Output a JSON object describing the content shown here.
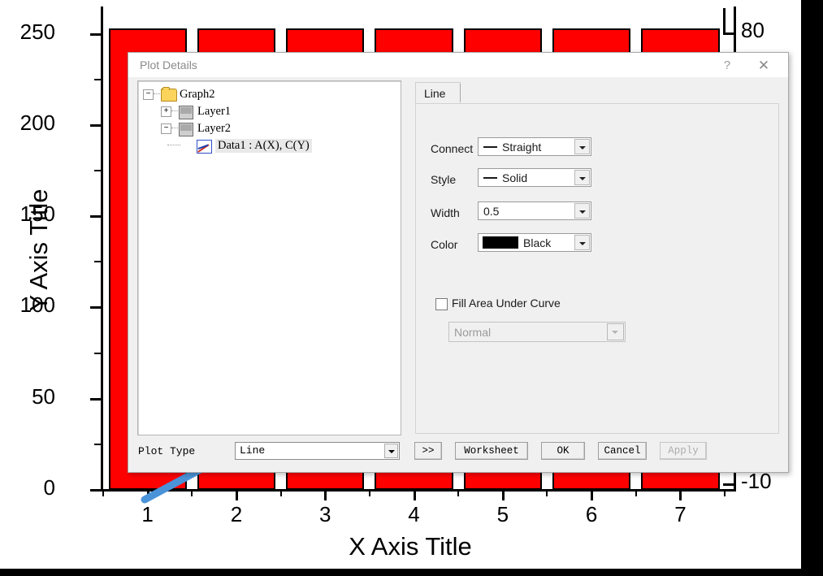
{
  "chart_data": {
    "type": "bar",
    "title": "",
    "xlabel": "X Axis Title",
    "ylabel": "Y Axis Title",
    "categories": [
      "1",
      "2",
      "3",
      "4",
      "5",
      "6",
      "7"
    ],
    "values": [
      253,
      253,
      253,
      253,
      253,
      253,
      253
    ],
    "series": [
      {
        "name": "C(Y)",
        "values": [
          253,
          253,
          253,
          253,
          253,
          253,
          253
        ],
        "color": "#FF0000"
      }
    ],
    "x_ticks": [
      "1",
      "2",
      "3",
      "4",
      "5",
      "6",
      "7"
    ],
    "y_ticks": [
      "0",
      "50",
      "100",
      "150",
      "200",
      "250"
    ],
    "ylim": [
      0,
      265
    ],
    "xlim": [
      0.5,
      7.6
    ],
    "right_axis": {
      "ticks": [
        "80",
        "-10"
      ],
      "ylim": [
        -10,
        80
      ]
    },
    "grid": false,
    "legend": "none",
    "bar_color": "#FF0000",
    "bar_edge_color": "#000000"
  },
  "annotation": {
    "arrow_color": "#4A93D9",
    "points_to": "plot-type-dropdown"
  },
  "dialog": {
    "title": "Plot Details",
    "help_glyph": "?",
    "close_glyph": "✕",
    "tree": {
      "nodes": [
        {
          "label": "Graph2",
          "toggle": "−",
          "icon": "folder-icon",
          "indent": 0,
          "selected": false
        },
        {
          "label": "Layer1",
          "toggle": "+",
          "icon": "layer-icon",
          "indent": 1,
          "selected": false
        },
        {
          "label": "Layer2",
          "toggle": "−",
          "icon": "layer-icon",
          "indent": 1,
          "selected": false
        },
        {
          "label": "Data1 : A(X), C(Y)",
          "toggle": "",
          "icon": "plot-icon",
          "indent": 2,
          "selected": true
        }
      ]
    },
    "tabs": [
      {
        "label": "Line",
        "active": true
      }
    ],
    "fields": {
      "connect": {
        "label": "Connect",
        "value": "Straight",
        "has_line_preview": true
      },
      "style": {
        "label": "Style",
        "value": "Solid",
        "has_line_preview": true
      },
      "width": {
        "label": "Width",
        "value": "0.5",
        "has_line_preview": false
      },
      "color": {
        "label": "Color",
        "value": "Black",
        "swatch": "#000000"
      }
    },
    "fill": {
      "checkbox_label": "Fill Area Under Curve",
      "checked": false,
      "mode_value": "Normal",
      "mode_enabled": false
    },
    "footer": {
      "plot_type_label": "Plot Type",
      "plot_type_value": "Line",
      "buttons": [
        {
          "label": ">>",
          "enabled": true
        },
        {
          "label": "Worksheet",
          "enabled": true
        },
        {
          "label": "OK",
          "enabled": true
        },
        {
          "label": "Cancel",
          "enabled": true
        },
        {
          "label": "Apply",
          "enabled": false
        }
      ]
    }
  }
}
